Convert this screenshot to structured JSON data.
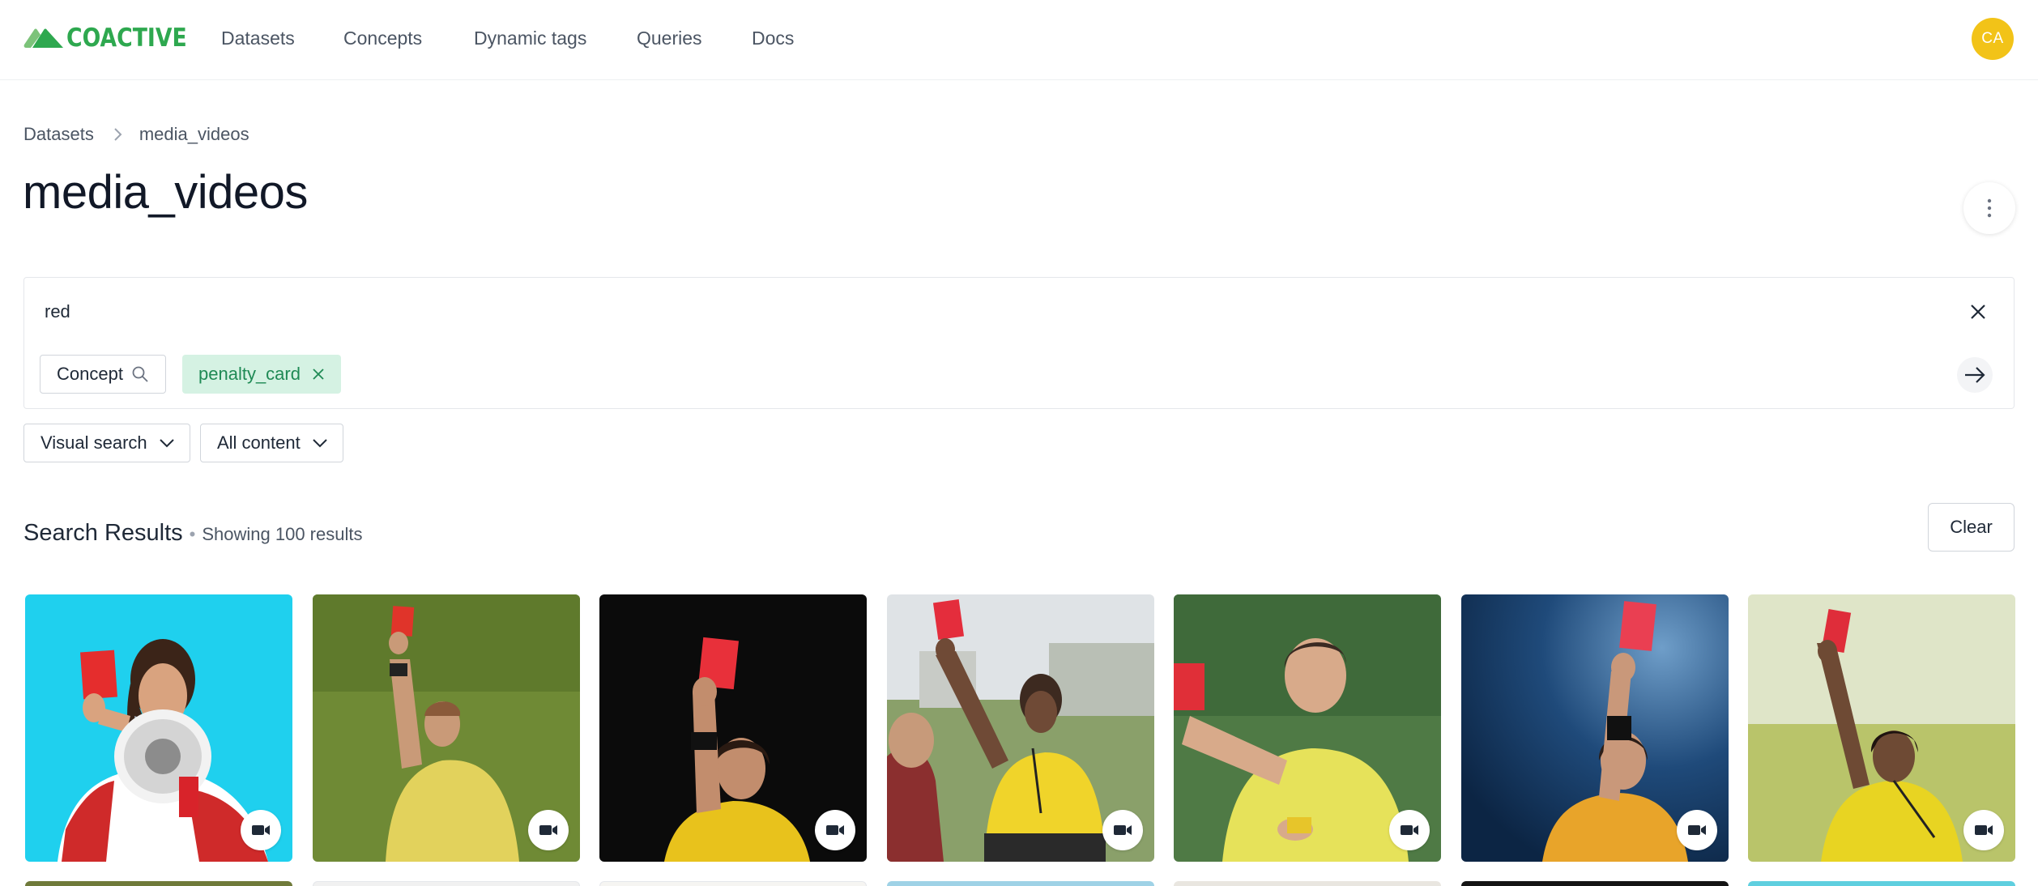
{
  "brand": {
    "name": "COACTIVE",
    "color": "#2ea84f"
  },
  "nav": {
    "items": [
      {
        "label": "Datasets"
      },
      {
        "label": "Concepts"
      },
      {
        "label": "Dynamic tags"
      },
      {
        "label": "Queries"
      },
      {
        "label": "Docs"
      }
    ],
    "avatar_initials": "CA",
    "avatar_color": "#f2c318"
  },
  "breadcrumb": {
    "root": "Datasets",
    "current": "media_videos"
  },
  "page": {
    "title": "media_videos"
  },
  "search": {
    "query": "red",
    "concept_chip_label": "Concept",
    "tag_chip_label": "penalty_card"
  },
  "filters": {
    "search_mode": "Visual search",
    "content_type": "All content"
  },
  "results": {
    "title": "Search Results",
    "separator": "•",
    "count_text": "Showing 100 results",
    "clear_label": "Clear",
    "tiles": [
      {
        "media_type": "video",
        "icon": "video-camera-icon"
      },
      {
        "media_type": "video",
        "icon": "video-camera-icon"
      },
      {
        "media_type": "video",
        "icon": "video-camera-icon"
      },
      {
        "media_type": "video",
        "icon": "video-camera-icon"
      },
      {
        "media_type": "video",
        "icon": "video-camera-icon"
      },
      {
        "media_type": "video",
        "icon": "video-camera-icon"
      },
      {
        "media_type": "video",
        "icon": "video-camera-icon"
      }
    ]
  }
}
